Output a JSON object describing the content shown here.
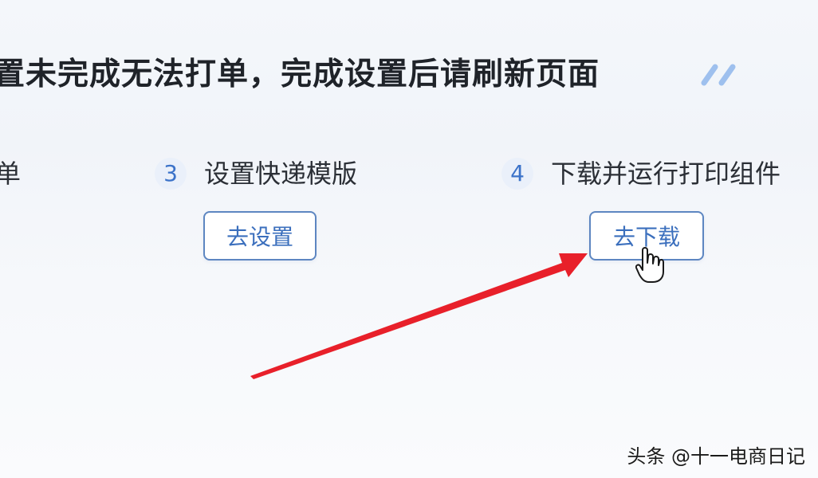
{
  "notice": {
    "title": "置未完成无法打单，完成设置后请刷新页面"
  },
  "steps": [
    {
      "label_partial": "单"
    },
    {
      "number": "3",
      "label": "设置快递模版",
      "button": "去设置"
    },
    {
      "number": "4",
      "label": "下载并运行打印组件",
      "button": "去下载"
    }
  ],
  "watermark": "头条 @十一电商日记",
  "colors": {
    "accent": "#3b6fbd",
    "button_border": "#5d86c1",
    "arrow": "#e8202a"
  },
  "icons": {
    "title_decoration": "double-slash-icon",
    "pointer": "hand-pointer-icon"
  }
}
